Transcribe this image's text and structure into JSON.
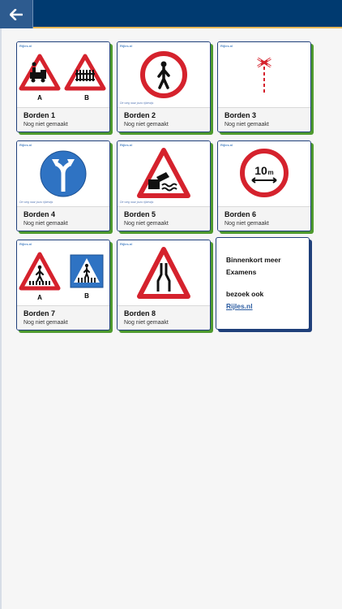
{
  "header": {
    "back_icon": "arrow-left-icon"
  },
  "colors": {
    "topbar": "#003a70",
    "accent": "#e6b85a",
    "card_border": "#1f3f7a",
    "card_shadow": "#4e9a2e",
    "sign_red": "#d5222d",
    "sign_blue": "#2f73c3",
    "link": "#2f5fa3"
  },
  "brand": {
    "logo_text": "Rijles.nl",
    "tagline": "De weg naar jouw rijbewijs"
  },
  "cards": [
    {
      "title": "Borden 1",
      "status": "Nog niet gemaakt",
      "labels": [
        "A",
        "B"
      ]
    },
    {
      "title": "Borden 2",
      "status": "Nog niet gemaakt"
    },
    {
      "title": "Borden 3",
      "status": "Nog niet gemaakt"
    },
    {
      "title": "Borden 4",
      "status": "Nog niet gemaakt"
    },
    {
      "title": "Borden 5",
      "status": "Nog niet gemaakt"
    },
    {
      "title": "Borden 6",
      "status": "Nog niet gemaakt",
      "sign_text": "10",
      "sign_unit": "m"
    },
    {
      "title": "Borden 7",
      "status": "Nog niet gemaakt",
      "labels": [
        "A",
        "B"
      ]
    },
    {
      "title": "Borden 8",
      "status": "Nog niet gemaakt"
    }
  ],
  "info": {
    "title": "Binnenkort meer Examens",
    "subtitle": "bezoek ook",
    "link": "Rijles.nl"
  }
}
